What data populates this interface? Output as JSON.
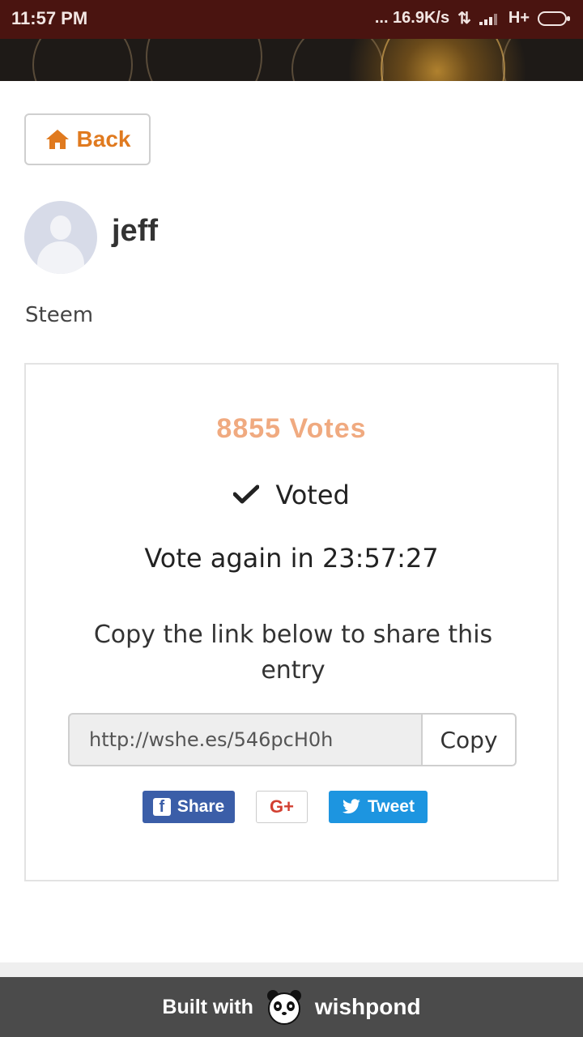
{
  "status_bar": {
    "time": "11:57 PM",
    "speed": "... 16.9K/s",
    "network": "H+"
  },
  "nav": {
    "back_label": "Back"
  },
  "entry": {
    "username": "jeff",
    "category": "Steem"
  },
  "vote_card": {
    "votes": "8855 Votes",
    "voted_label": "Voted",
    "vote_again": "Vote again in 23:57:27",
    "share_prompt": "Copy the link below to share this entry",
    "share_link": "http://wshe.es/546pcH0h",
    "copy_label": "Copy",
    "facebook_label": "Share",
    "googleplus_label": "G+",
    "twitter_label": "Tweet"
  },
  "footer": {
    "built_with": "Built with",
    "brand": "wishpond"
  },
  "colors": {
    "accent": "#e07a1f",
    "votes": "#f0aa80",
    "facebook": "#3b5ea8",
    "twitter": "#1d95e0",
    "googleplus": "#d23f31",
    "footer": "#4b4b4b",
    "status_bar": "#4a1410"
  },
  "icons": {
    "back": "home-icon",
    "voted": "check-icon",
    "facebook": "facebook-icon",
    "twitter": "twitter-bird-icon",
    "footer_logo": "panda-icon"
  }
}
